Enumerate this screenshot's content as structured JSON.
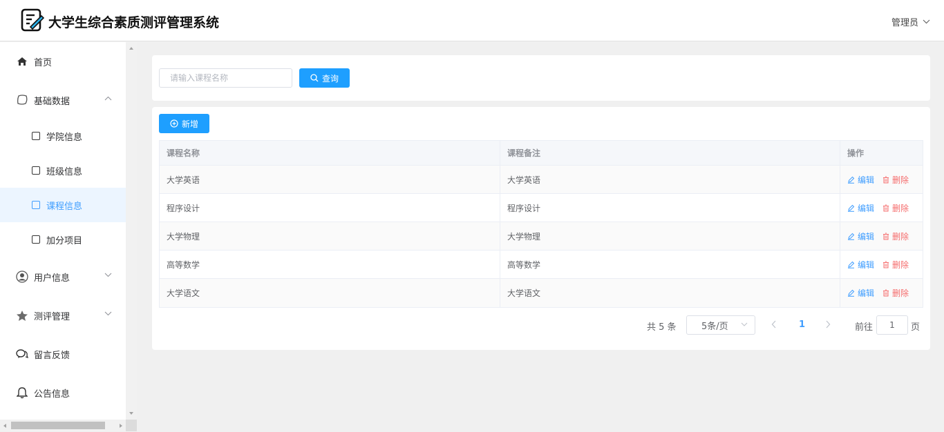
{
  "header": {
    "title": "大学生综合素质测评管理系统",
    "user": "管理员",
    "logo_icon": "edit-document-icon",
    "user_chevron_icon": "chevron-down-icon"
  },
  "sidebar": {
    "items": [
      {
        "label": "首页",
        "icon": "home-icon"
      },
      {
        "label": "基础数据",
        "icon": "chat-bubble-icon",
        "expanded": true,
        "children": [
          {
            "label": "学院信息"
          },
          {
            "label": "班级信息"
          },
          {
            "label": "课程信息",
            "active": true
          },
          {
            "label": "加分项目"
          }
        ]
      },
      {
        "label": "用户信息",
        "icon": "user-circle-icon",
        "expanded": false
      },
      {
        "label": "测评管理",
        "icon": "star-icon",
        "expanded": false
      },
      {
        "label": "留言反馈",
        "icon": "message-icon"
      },
      {
        "label": "公告信息",
        "icon": "bell-icon"
      }
    ]
  },
  "search": {
    "placeholder": "请输入课程名称",
    "value": "",
    "button_label": "查询"
  },
  "toolbar": {
    "add_label": "新增"
  },
  "table": {
    "columns": [
      "课程名称",
      "课程备注",
      "操作"
    ],
    "rows": [
      {
        "name": "大学英语",
        "note": "大学英语"
      },
      {
        "name": "程序设计",
        "note": "程序设计"
      },
      {
        "name": "大学物理",
        "note": "大学物理"
      },
      {
        "name": "高等数学",
        "note": "高等数学"
      },
      {
        "name": "大学语文",
        "note": "大学语文"
      }
    ],
    "edit_label": "编辑",
    "delete_label": "删除"
  },
  "pagination": {
    "total_text": "共 5 条",
    "page_size": "5条/页",
    "current_page": "1",
    "goto_label": "前往",
    "goto_value": "1",
    "page_suffix": "页"
  },
  "colors": {
    "primary": "#1e9fff",
    "link": "#409eff",
    "danger": "#f56c6c",
    "active_bg": "#ecf5ff"
  }
}
